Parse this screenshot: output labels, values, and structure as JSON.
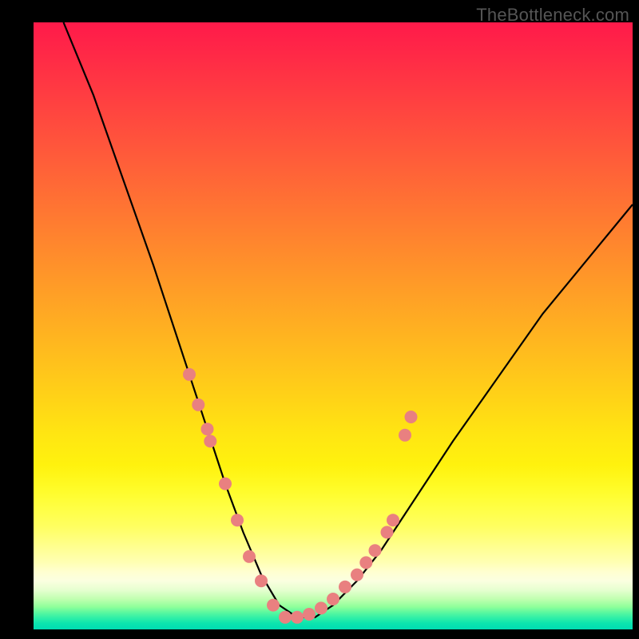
{
  "watermark": "TheBottleneck.com",
  "chart_data": {
    "type": "line",
    "title": "",
    "xlabel": "",
    "ylabel": "",
    "xlim": [
      0,
      100
    ],
    "ylim": [
      0,
      100
    ],
    "grid": false,
    "legend": false,
    "description": "Asymmetric V-shaped bottleneck curve on rainbow gradient background (red=high bottleneck, green=low). Trough near x≈42 with salmon scatter markers clustered around the trough ±15.",
    "series": [
      {
        "name": "bottleneck-curve",
        "color": "#000000",
        "x": [
          5,
          10,
          15,
          20,
          23,
          26,
          29,
          32,
          35,
          38,
          41,
          44,
          47,
          50,
          54,
          58,
          62,
          66,
          70,
          75,
          80,
          85,
          90,
          95,
          100
        ],
        "y": [
          100,
          88,
          74,
          60,
          51,
          42,
          33,
          24,
          16,
          9,
          4,
          2,
          2,
          4,
          8,
          13,
          19,
          25,
          31,
          38,
          45,
          52,
          58,
          64,
          70
        ]
      }
    ],
    "scatter": {
      "name": "markers",
      "color": "#e98080",
      "radius": 8,
      "points": [
        {
          "x": 26,
          "y": 42
        },
        {
          "x": 27.5,
          "y": 37
        },
        {
          "x": 29,
          "y": 33
        },
        {
          "x": 29.5,
          "y": 31
        },
        {
          "x": 32,
          "y": 24
        },
        {
          "x": 34,
          "y": 18
        },
        {
          "x": 36,
          "y": 12
        },
        {
          "x": 38,
          "y": 8
        },
        {
          "x": 40,
          "y": 4
        },
        {
          "x": 42,
          "y": 2
        },
        {
          "x": 44,
          "y": 2
        },
        {
          "x": 46,
          "y": 2.5
        },
        {
          "x": 48,
          "y": 3.5
        },
        {
          "x": 50,
          "y": 5
        },
        {
          "x": 52,
          "y": 7
        },
        {
          "x": 54,
          "y": 9
        },
        {
          "x": 55.5,
          "y": 11
        },
        {
          "x": 57,
          "y": 13
        },
        {
          "x": 59,
          "y": 16
        },
        {
          "x": 60,
          "y": 18
        },
        {
          "x": 62,
          "y": 32
        },
        {
          "x": 63,
          "y": 35
        }
      ]
    }
  }
}
